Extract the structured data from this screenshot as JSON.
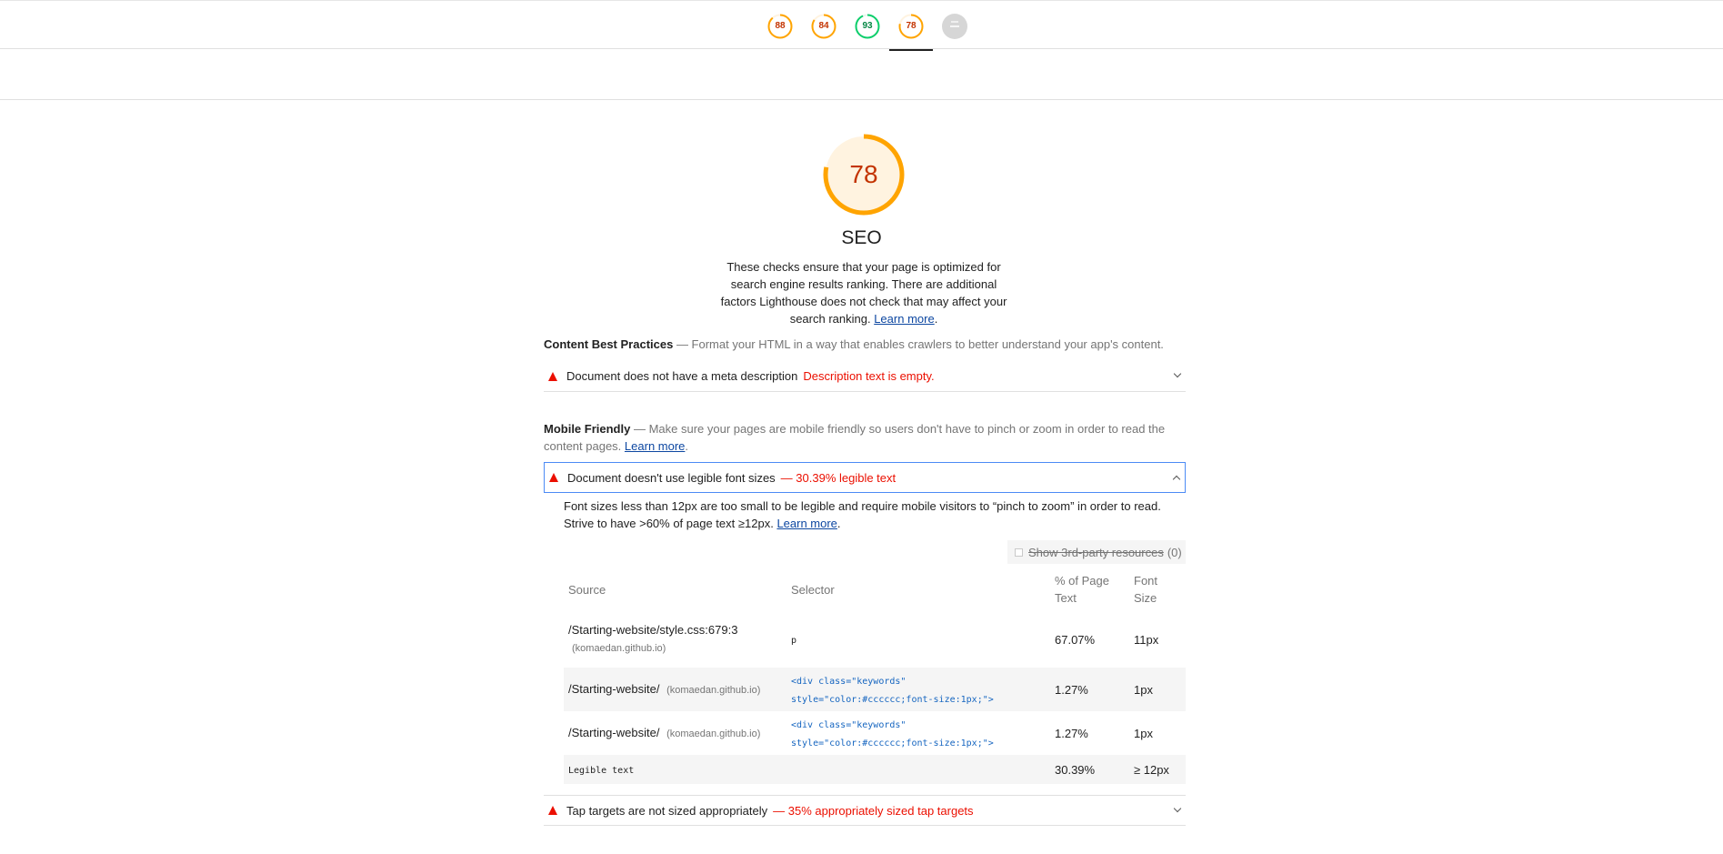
{
  "top_gauges": [
    {
      "name": "performance",
      "score": "88",
      "value": 0.88,
      "color": "#ffa400"
    },
    {
      "name": "accessibility",
      "score": "84",
      "value": 0.84,
      "color": "#ffa400"
    },
    {
      "name": "best-practices",
      "score": "93",
      "value": 0.93,
      "color": "#0cce6b"
    },
    {
      "name": "seo",
      "score": "78",
      "value": 0.78,
      "color": "#ffa400",
      "active": true
    },
    {
      "name": "pwa",
      "score": "",
      "value": 0,
      "color": "#cccccc"
    }
  ],
  "category": {
    "score": "78",
    "score_value": 0.78,
    "title": "SEO",
    "description": "These checks ensure that your page is optimized for search engine results ranking. There are additional factors Lighthouse does not check that may affect your search ranking.",
    "learn_more": "Learn more",
    "gauge_color": "#ffa400",
    "gauge_fill": "#fff3e0"
  },
  "groups": {
    "content": {
      "title": "Content Best Practices",
      "description": " — Format your HTML in a way that enables crawlers to better understand your app's content."
    },
    "mobile": {
      "title": "Mobile Friendly",
      "description": " — Make sure your pages are mobile friendly so users don't have to pinch or zoom in order to read the content pages.",
      "learn_more": "Learn more"
    }
  },
  "audits": {
    "meta_description": {
      "title": "Document does not have a meta description",
      "display": "Description text is empty."
    },
    "font_size": {
      "title": "Document doesn't use legible font sizes",
      "display": "— 30.39% legible text",
      "description": "Font sizes less than 12px are too small to be legible and require mobile visitors to “pinch to zoom” in order to read. Strive to have >60% of page text ≥12px.",
      "learn_more": "Learn more",
      "third_party_label": "Show 3rd-party resources",
      "third_party_count": "(0)",
      "table": {
        "headers": [
          "Source",
          "Selector",
          "% of Page Text",
          "Font Size"
        ],
        "rows": [
          {
            "source": "/Starting-website/style.css:679:3",
            "host": "(komaedan.github.io)",
            "selector": "p",
            "percent": "67.07%",
            "size": "11px"
          },
          {
            "source": "/Starting-website/",
            "host": "(komaedan.github.io)",
            "selector": "<div class=\"keywords\" style=\"color:#cccccc;font-size:1px;\">",
            "percent": "1.27%",
            "size": "1px"
          },
          {
            "source": "/Starting-website/",
            "host": "(komaedan.github.io)",
            "selector": "<div class=\"keywords\" style=\"color:#cccccc;font-size:1px;\">",
            "percent": "1.27%",
            "size": "1px"
          },
          {
            "source": "Legible text",
            "host": "",
            "selector": "",
            "percent": "30.39%",
            "size": "≥ 12px"
          }
        ]
      }
    },
    "tap_targets": {
      "title": "Tap targets are not sized appropriately",
      "display": "— 35% appropriately sized tap targets"
    }
  },
  "colors": {
    "fail": "#eb0f00",
    "average": "#ffa400",
    "pass": "#0cce6b",
    "link": "#0d47a1"
  }
}
